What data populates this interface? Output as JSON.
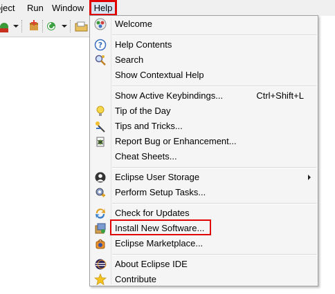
{
  "menubar": {
    "project": "oject",
    "run": "Run",
    "window": "Window",
    "help": "Help"
  },
  "toolbar": {
    "icons": [
      "run-icon",
      "new-package-icon",
      "refresh-icon",
      "open-folder-icon"
    ]
  },
  "help_menu": {
    "items": [
      {
        "label": "Welcome",
        "icon": "welcome-icon"
      },
      {
        "label": "Help Contents",
        "icon": "help-contents-icon"
      },
      {
        "label": "Search",
        "icon": "search-icon"
      },
      {
        "label": "Show Contextual Help",
        "icon": ""
      },
      {
        "label": "Show Active Keybindings...",
        "accelerator": "Ctrl+Shift+L"
      },
      {
        "label": "Tip of the Day",
        "icon": "lightbulb-icon"
      },
      {
        "label": "Tips and Tricks...",
        "icon": "tips-icon"
      },
      {
        "label": "Report Bug or Enhancement...",
        "icon": "bug-icon"
      },
      {
        "label": "Cheat Sheets...",
        "icon": ""
      },
      {
        "label": "Eclipse User Storage",
        "icon": "user-storage-icon",
        "submenu": true
      },
      {
        "label": "Perform Setup Tasks...",
        "icon": "setup-icon"
      },
      {
        "label": "Check for Updates",
        "icon": "update-icon"
      },
      {
        "label": "Install New Software...",
        "icon": "install-icon",
        "highlighted": true
      },
      {
        "label": "Eclipse Marketplace...",
        "icon": "marketplace-icon"
      },
      {
        "label": "About Eclipse IDE",
        "icon": "eclipse-icon"
      },
      {
        "label": "Contribute",
        "icon": "star-icon"
      }
    ]
  },
  "colors": {
    "highlight_box": "#e00000",
    "menu_bg": "#f5f5f5",
    "menubar_bg": "#f0f0f0"
  }
}
